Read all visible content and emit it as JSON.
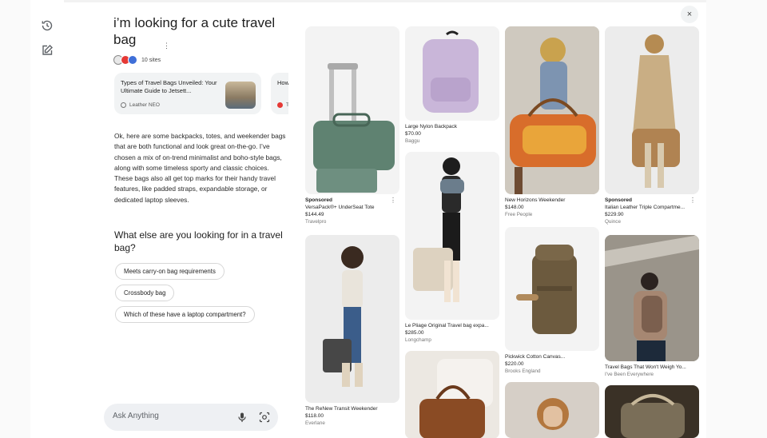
{
  "query": {
    "title": "i’m looking for a cute travel bag",
    "sites_count": "10 sites"
  },
  "sources": [
    {
      "title": "Types of Travel Bags Unveiled: Your Ultimate Guide to Jetsett...",
      "site": "Leather NEO"
    },
    {
      "title": "How",
      "site": "Tr"
    }
  ],
  "answer": {
    "body": "Ok, here are some backpacks, totes, and weekender bags that are both functional and look great on-the-go. I’ve chosen a mix of on-trend minimalist and boho-style bags, along with some timeless sporty and classic choices. These bags also all get top marks for their handy travel features, like padded straps, expandable storage, or dedicated laptop sleeves.",
    "followup_question": "What else are you looking for in a travel bag?",
    "chips": [
      "Meets carry-on bag requirements",
      "Crossbody bag",
      "Which of these have a laptop compartment?"
    ]
  },
  "ask": {
    "placeholder": "Ask Anything"
  },
  "icons": {
    "history": "history-icon",
    "new_chat": "edit-icon",
    "close": "close-icon",
    "mic": "mic-icon",
    "lens": "camera-search-icon",
    "more": "more-vert-icon"
  },
  "close_label": "×",
  "more_label": "⋮",
  "products": [
    {
      "sponsored": "Sponsored",
      "name": "VersaPack®+ UnderSeat Tote",
      "price": "$144.49",
      "store": "Travelpro"
    },
    {
      "sponsored": "",
      "name": "The ReNew Transit Weekender",
      "price": "$118.00",
      "store": "Everlane"
    },
    {
      "sponsored": "",
      "name": "Large Nylon Backpack",
      "price": "$70.00",
      "store": "Baggu"
    },
    {
      "sponsored": "",
      "name": "Le Pliage Original Travel bag expa...",
      "price": "$285.00",
      "store": "Longchamp"
    },
    {
      "sponsored": "",
      "name": "New Horizons Weekender",
      "price": "$148.00",
      "store": "Free People"
    },
    {
      "sponsored": "",
      "name": "Pickwick Cotton Canvas...",
      "price": "$220.00",
      "store": "Brooks England"
    },
    {
      "sponsored": "Sponsored",
      "name": "Italian Leather Triple Compartme...",
      "price": "$229.90",
      "store": "Quince"
    },
    {
      "sponsored": "",
      "name": "Travel Bags That Won't Weigh Yo...",
      "price": "",
      "store": "I've Been Everywhere"
    }
  ],
  "colors": {
    "accent_blue": "#3f6fd8",
    "chip_border": "#d7d7d7",
    "search_bg": "#eef0f3"
  }
}
